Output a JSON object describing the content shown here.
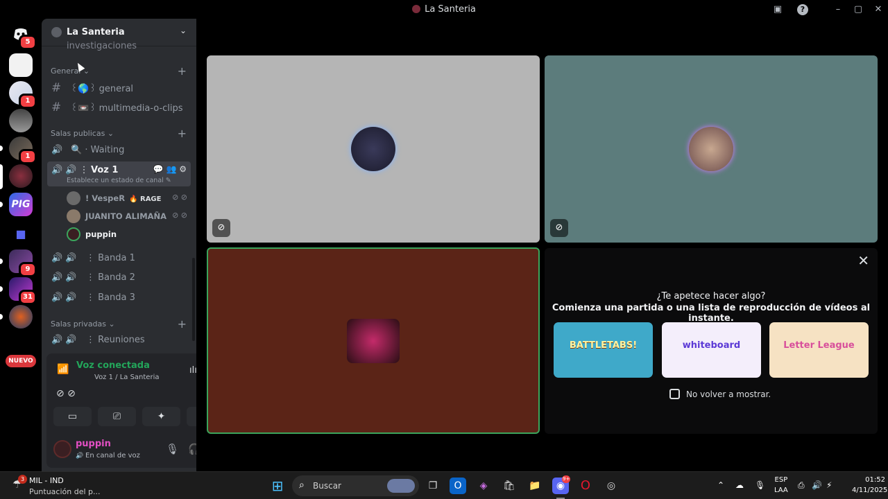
{
  "window": {
    "title": "La Santeria",
    "monitor_icon": "monitor-icon",
    "help_icon": "help-icon",
    "minimize": "–",
    "maximize": "▢",
    "close": "✕"
  },
  "guilds": {
    "home_badge": "5",
    "items": [
      {
        "name": "server-a",
        "badge": ""
      },
      {
        "name": "server-b",
        "badge": "1"
      },
      {
        "name": "server-c",
        "badge": ""
      },
      {
        "name": "server-d",
        "badge": "1"
      },
      {
        "name": "server-la-santeria",
        "badge": ""
      },
      {
        "name": "server-pig",
        "badge": ""
      },
      {
        "name": "folder",
        "badge": ""
      },
      {
        "name": "server-meltdown",
        "badge": "9"
      },
      {
        "name": "server-purple",
        "badge": "31"
      },
      {
        "name": "server-game",
        "badge": ""
      }
    ],
    "new_label": "NUEVO"
  },
  "server": {
    "name": "La Santeria",
    "partial_channel": "investigaciones",
    "categories": [
      {
        "label": "General"
      },
      {
        "label": "Salas publicas"
      },
      {
        "label": "Salas privadas"
      }
    ],
    "text_channels": [
      {
        "label": "꒰🌎꒱ general"
      },
      {
        "label": "꒰📼꒱ multimedia-o-clips"
      }
    ],
    "waiting": "🔍 · Waiting",
    "active_voice": {
      "label": "Voz 1",
      "status": "Establece un estado de canal ✎"
    },
    "voice_users": [
      {
        "name": "! VespeR",
        "tag": "🔥 RAGE",
        "color": "#949ba4"
      },
      {
        "name": "JUANITO ALIMAÑA",
        "tag": "",
        "color": "#949ba4"
      },
      {
        "name": "puppin",
        "tag": "",
        "color": "#f2f3f5"
      }
    ],
    "voice_channels": [
      {
        "label": "Banda 1"
      },
      {
        "label": "Banda 2"
      },
      {
        "label": "Banda 3"
      }
    ],
    "private_channel": "Reuniones"
  },
  "voice_panel": {
    "status": "Voz conectada",
    "sub": "Voz 1 / La Santeria"
  },
  "user": {
    "name": "puppin",
    "status": "En canal de voz"
  },
  "activity": {
    "heading": "¿Te apetece hacer algo?",
    "subheading": "Comienza una partida o una lista de reproducción de vídeos al instante.",
    "cards": [
      {
        "label": "BATTLETABS!",
        "bg": "#3fa9c9",
        "fg": "#fff3a0"
      },
      {
        "label": "whiteboard",
        "bg": "#f4eefb",
        "fg": "#5b39d6"
      },
      {
        "label": "Letter League",
        "bg": "#f6e2c3",
        "fg": "#d84f9b"
      }
    ],
    "dont_show": "No volver a mostrar."
  },
  "taskbar": {
    "weather_badge": "3",
    "weather_title": "MIL - IND",
    "weather_sub": "Puntuación del p...",
    "search_placeholder": "Buscar",
    "lang_top": "ESP",
    "lang_bottom": "LAA",
    "time": "01:52",
    "date": "4/11/2025",
    "discord_badge": "9+"
  },
  "colors": {
    "tile1": "#b5b5b5",
    "tile2": "#5c7c7c",
    "tile3": "#5b2417",
    "speaking": "#3ba55c",
    "accent": "#5865f2"
  }
}
